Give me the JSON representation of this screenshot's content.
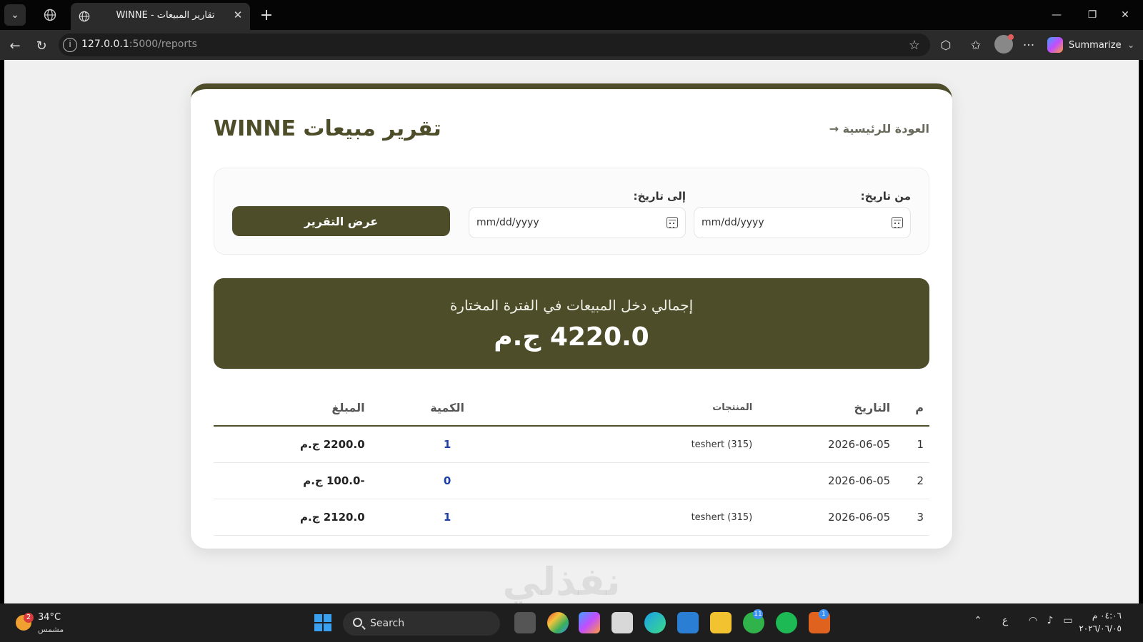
{
  "browser": {
    "tab_title": "WINNE - تقارير المبيعات",
    "url_host": "127.0.0.1",
    "url_rest": ":5000/reports",
    "summarize_label": "Summarize"
  },
  "page": {
    "title": "تقرير مبيعات WINNE",
    "back_link": "العودة للرئيسية →",
    "filters": {
      "from_label": "من تاريخ:",
      "to_label": "إلى تاريخ:",
      "from_value": "mm/dd/yyyy",
      "to_value": "mm/dd/yyyy",
      "submit_label": "عرض التقرير"
    },
    "total": {
      "label": "إجمالي دخل المبيعات في الفترة المختارة",
      "value": "4220.0 ج.م"
    },
    "table": {
      "headers": {
        "index": "م",
        "date": "التاريخ",
        "products": "المنتجات",
        "quantity": "الكمية",
        "amount": "المبلغ"
      },
      "rows": [
        {
          "index": "1",
          "date": "2026-06-05",
          "products": "teshert (315)",
          "quantity": "1",
          "amount": "2200.0 ج.م"
        },
        {
          "index": "2",
          "date": "2026-06-05",
          "products": "",
          "quantity": "0",
          "amount": "-100.0 ج.م"
        },
        {
          "index": "3",
          "date": "2026-06-05",
          "products": "teshert (315)",
          "quantity": "1",
          "amount": "2120.0 ج.م"
        }
      ]
    },
    "watermark": "نفذلي"
  },
  "taskbar": {
    "weather_temp": "34°C",
    "weather_desc": "مشمس",
    "weather_badge": "2",
    "search_label": "Search",
    "whatsapp_badge": "11",
    "app_badge": "1",
    "lang": "ع",
    "time": "٠٤:٠٦ م",
    "date": "٢٠٢٦/٠٦/٠٥"
  },
  "colors": {
    "primary": "#4d4d29",
    "quantity_text": "#1e3ea8"
  }
}
